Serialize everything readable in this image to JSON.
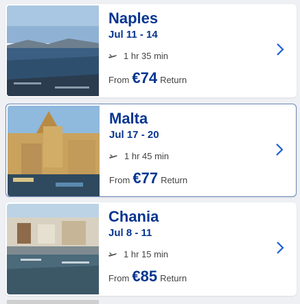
{
  "results": [
    {
      "city": "Naples",
      "dates": "Jul 11 - 14",
      "duration": "1 hr 35 min",
      "from_label": "From",
      "price": "€74",
      "trip_type": "Return",
      "image": "naples-bay-photo"
    },
    {
      "city": "Malta",
      "dates": "Jul 17 - 20",
      "duration": "1 hr 45 min",
      "from_label": "From",
      "price": "€77",
      "trip_type": "Return",
      "image": "malta-church-photo",
      "selected": true
    },
    {
      "city": "Chania",
      "dates": "Jul 8 - 11",
      "duration": "1 hr 15 min",
      "from_label": "From",
      "price": "€85",
      "trip_type": "Return",
      "image": "chania-harbour-photo"
    }
  ],
  "colors": {
    "accent": "#073590",
    "chevron": "#1a5fd6",
    "selected_border": "#6b86b8"
  }
}
